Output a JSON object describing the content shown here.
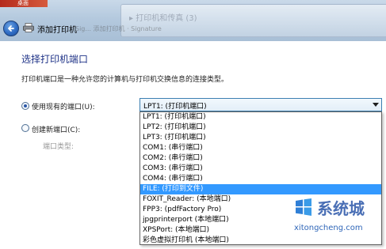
{
  "titlebar": {
    "top_left_text": "桌面",
    "title": "添加打印机",
    "faded_text": "Sig... 添加打印机 · Signature",
    "bg_window_text": "▸ 打印机和传真 (3)"
  },
  "page": {
    "heading": "选择打印机端口",
    "description": "打印机端口是一种允许您的计算机与打印机交换信息的连接类型。",
    "use_existing_label": "使用现有的端口(U):",
    "create_new_label": "创建新端口(C):",
    "port_type_label": "端口类型:"
  },
  "combo": {
    "selected_value": "LPT1: (打印机端口)"
  },
  "dropdown": {
    "selected_index": 7,
    "items": [
      "LPT1: (打印机端口)",
      "LPT2: (打印机端口)",
      "LPT3: (打印机端口)",
      "COM1: (串行端口)",
      "COM2: (串行端口)",
      "COM3: (串行端口)",
      "COM4: (串行端口)",
      "FILE: (打印到文件)",
      "FOXIT_Reader: (本地端口)",
      "FPP3: (pdfFactory Pro)",
      "jpgprinterport (本地端口)",
      "XPSPort: (本地端口)",
      "彩色虚拟打印机 (本地端口)"
    ]
  },
  "watermark": {
    "brand": "系统城",
    "domain": "xitongcheng.com"
  },
  "colors": {
    "heading": "#1e3287",
    "selection": "#3399ff",
    "combo_border": "#3c7fb1"
  }
}
